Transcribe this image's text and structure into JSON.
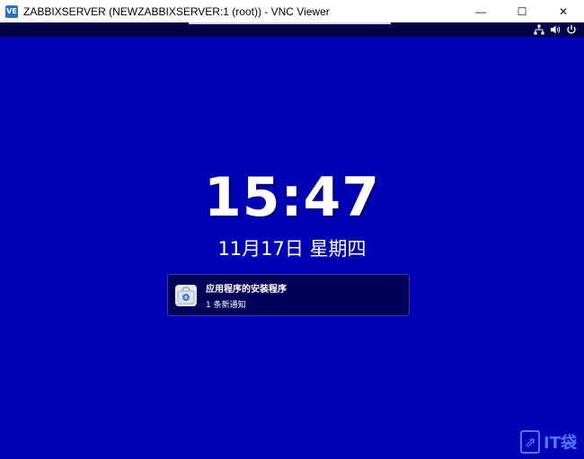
{
  "window": {
    "icon_label": "VE",
    "title": "ZABBIXSERVER (NEWZABBIXSERVER:1 (root)) - VNC Viewer",
    "minimize_glyph": "—",
    "maximize_glyph": "☐",
    "close_glyph": "✕"
  },
  "topbar": {
    "icons": [
      "network-icon",
      "volume-icon",
      "power-icon"
    ]
  },
  "lock_screen": {
    "time": "15:47",
    "date": "11月17日 星期四"
  },
  "notification": {
    "icon": "software-installer-icon",
    "title": "应用程序的安装程序",
    "subtitle": "1 条新通知"
  },
  "watermark": {
    "logo_text": "IT袋",
    "color": "#4c79ff"
  },
  "colors": {
    "desktop_bg": "#0000b4",
    "topbar_bg": "#000045",
    "notification_bg": "#000058"
  }
}
